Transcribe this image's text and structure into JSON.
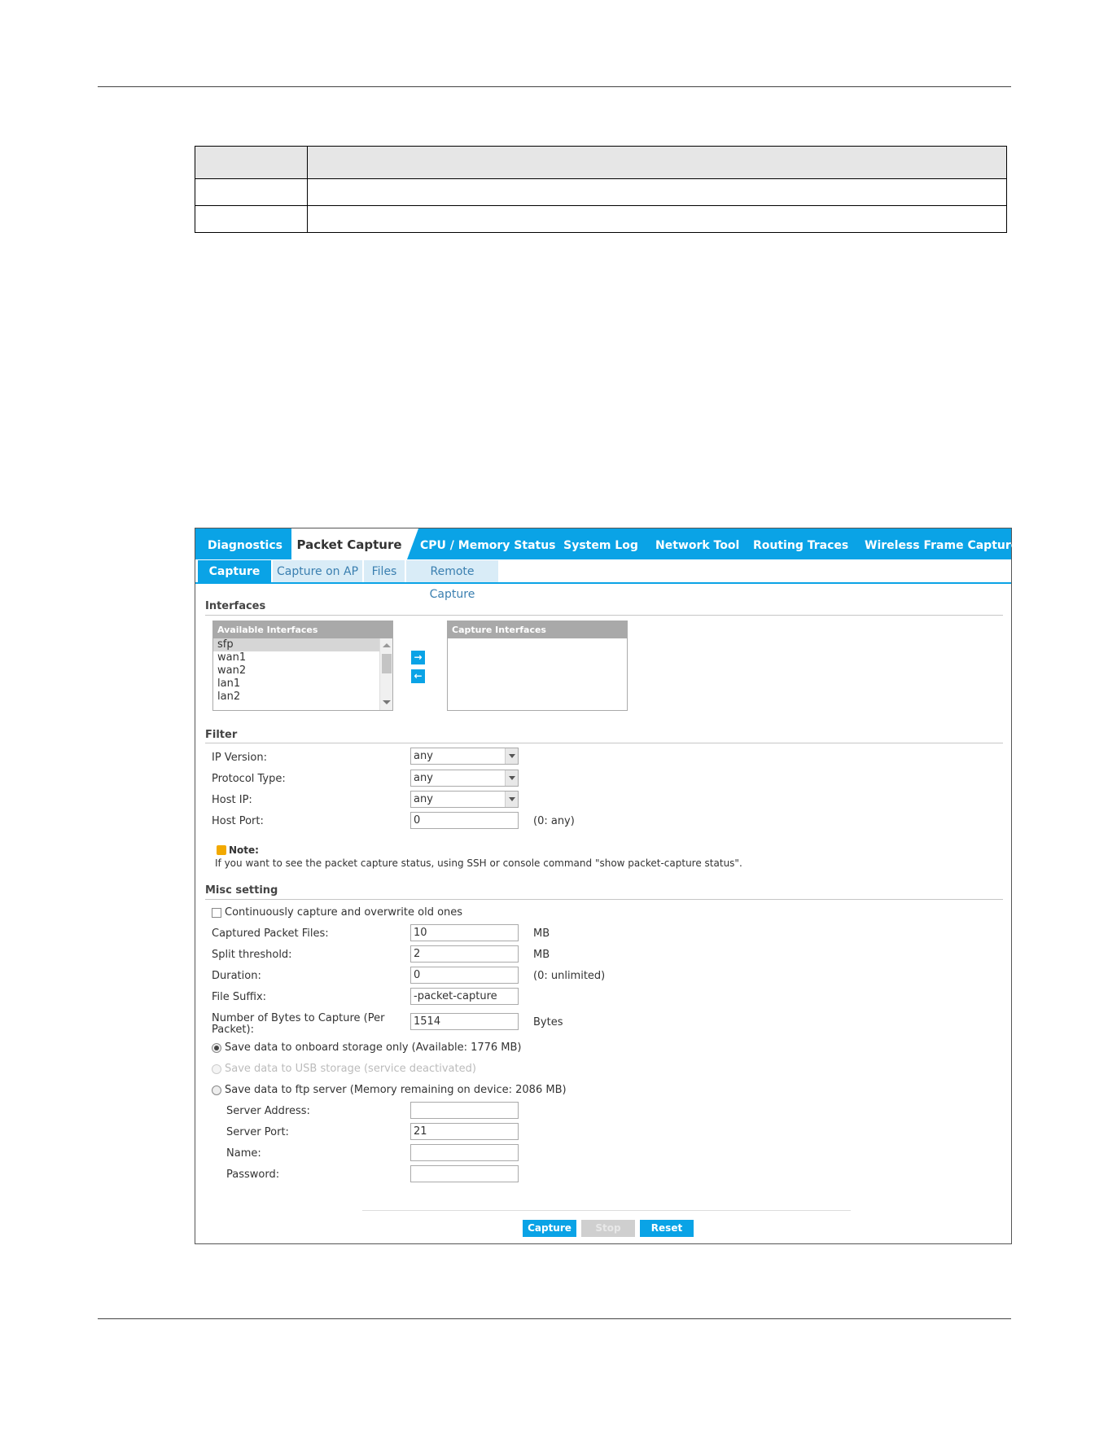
{
  "tabs": [
    "Diagnostics",
    "Packet Capture",
    "CPU / Memory Status",
    "System Log",
    "Network Tool",
    "Routing Traces",
    "Wireless Frame Capture"
  ],
  "subtabs": [
    "Capture",
    "Capture on AP",
    "Files",
    "Remote Capture"
  ],
  "interfaces": {
    "title": "Interfaces",
    "available_header": "Available Interfaces",
    "capture_header": "Capture Interfaces",
    "available_items": [
      "sfp",
      "wan1",
      "wan2",
      "lan1",
      "lan2"
    ],
    "add_symbol": "→",
    "remove_symbol": "←"
  },
  "filter": {
    "title": "Filter",
    "ip_version_label": "IP Version:",
    "ip_version_value": "any",
    "protocol_label": "Protocol Type:",
    "protocol_value": "any",
    "host_ip_label": "Host IP:",
    "host_ip_value": "any",
    "host_port_label": "Host Port:",
    "host_port_value": "0",
    "host_port_hint": "(0: any)",
    "note_title": "Note:",
    "note_text": "If you want to see the packet capture status, using SSH or console command \"show packet-capture status\"."
  },
  "misc": {
    "title": "Misc setting",
    "continuous_label": "Continuously capture and overwrite old ones",
    "captured_files_label": "Captured Packet Files:",
    "captured_files_value": "10",
    "captured_files_unit": "MB",
    "split_label": "Split threshold:",
    "split_value": "2",
    "split_unit": "MB",
    "duration_label": "Duration:",
    "duration_value": "0",
    "duration_hint": "(0: unlimited)",
    "suffix_label": "File Suffix:",
    "suffix_value": "-packet-capture",
    "bytes_label_line1": "Number of Bytes to Capture (Per",
    "bytes_label_line2": "Packet):",
    "bytes_value": "1514",
    "bytes_unit": "Bytes",
    "radio_onboard": "Save data to onboard storage only (Available: 1776 MB)",
    "radio_usb": "Save data to USB storage (service deactivated)",
    "radio_ftp": "Save data to ftp server (Memory remaining on device: 2086 MB)",
    "server_address_label": "Server Address:",
    "server_address_value": "",
    "server_port_label": "Server Port:",
    "server_port_value": "21",
    "name_label": "Name:",
    "name_value": "",
    "password_label": "Password:",
    "password_value": ""
  },
  "buttons": {
    "capture": "Capture",
    "stop": "Stop",
    "reset": "Reset"
  },
  "colors": {
    "accent": "#0aa3e6",
    "note": "#f2a900"
  }
}
